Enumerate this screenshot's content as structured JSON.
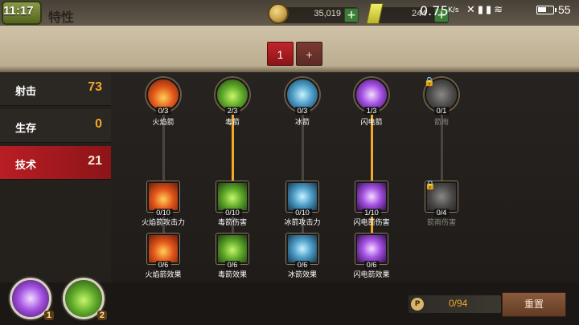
{
  "status_bar": {
    "clock": "11:17",
    "net_speed": "0.75",
    "net_unit": "K/s",
    "battery": "55"
  },
  "header": {
    "title": "特性",
    "coins": "35,019",
    "gems": "244",
    "page_tabs": [
      "1",
      "+"
    ]
  },
  "sidebar": {
    "items": [
      {
        "label": "射击",
        "value": "73"
      },
      {
        "label": "生存",
        "value": "0"
      },
      {
        "label": "技术",
        "value": "21"
      }
    ]
  },
  "skills": {
    "top": [
      {
        "label": "火焰箭",
        "count": "0/3",
        "icon": "fire-arrow-icon"
      },
      {
        "label": "毒箭",
        "count": "2/3",
        "icon": "poison-arrow-icon"
      },
      {
        "label": "冰箭",
        "count": "0/3",
        "icon": "ice-arrow-icon"
      },
      {
        "label": "闪电箭",
        "count": "1/3",
        "icon": "lightning-arrow-icon"
      },
      {
        "label": "箭雨",
        "count": "0/1",
        "icon": "arrow-rain-icon"
      }
    ],
    "mid": [
      {
        "label": "火焰箭攻击力",
        "count": "0/10"
      },
      {
        "label": "毒箭伤害",
        "count": "0/10"
      },
      {
        "label": "冰箭攻击力",
        "count": "0/10"
      },
      {
        "label": "闪电箭伤害",
        "count": "1/10"
      },
      {
        "label": "箭雨伤害",
        "count": "0/4"
      }
    ],
    "bottom": [
      {
        "label": "火焰箭效果",
        "count": "0/6"
      },
      {
        "label": "毒箭效果",
        "count": "0/6"
      },
      {
        "label": "冰箭效果",
        "count": "0/6"
      },
      {
        "label": "闪电箭效果",
        "count": "0/6"
      }
    ]
  },
  "quick_skills": [
    {
      "badge": "1"
    },
    {
      "badge": "2"
    }
  ],
  "footer": {
    "points_icon": "P",
    "points": "0/94",
    "reset_label": "重置"
  }
}
